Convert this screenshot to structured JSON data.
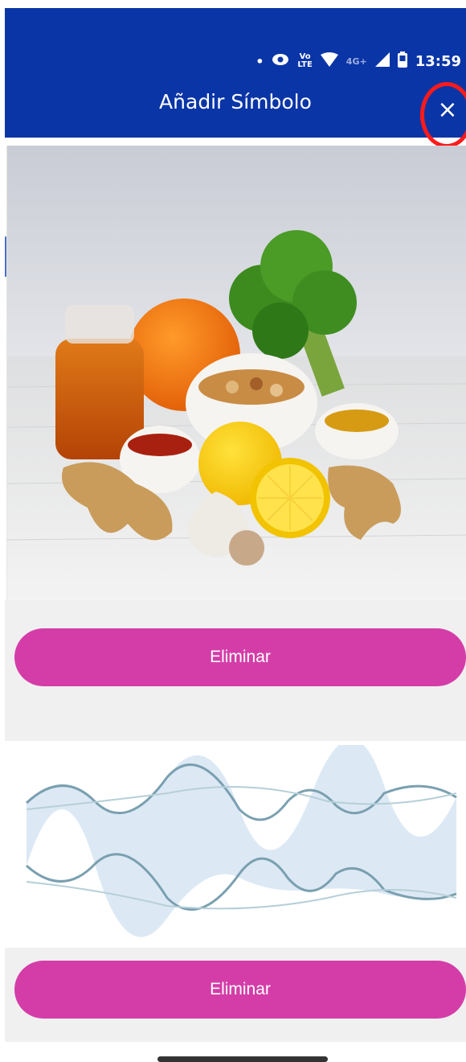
{
  "status_bar": {
    "dot": "•",
    "lte_top": "Vo",
    "lte_bottom": "LTE",
    "network": "4G+",
    "time": "13:59"
  },
  "header": {
    "title": "Añadir Símbolo",
    "close_glyph": "×"
  },
  "symbols": [
    {
      "delete_label": "Eliminar"
    },
    {
      "delete_label": "Eliminar"
    }
  ],
  "colors": {
    "app_bar": "#0a35a7",
    "delete_button": "#d43da8",
    "highlight": "#ff1a1a"
  }
}
